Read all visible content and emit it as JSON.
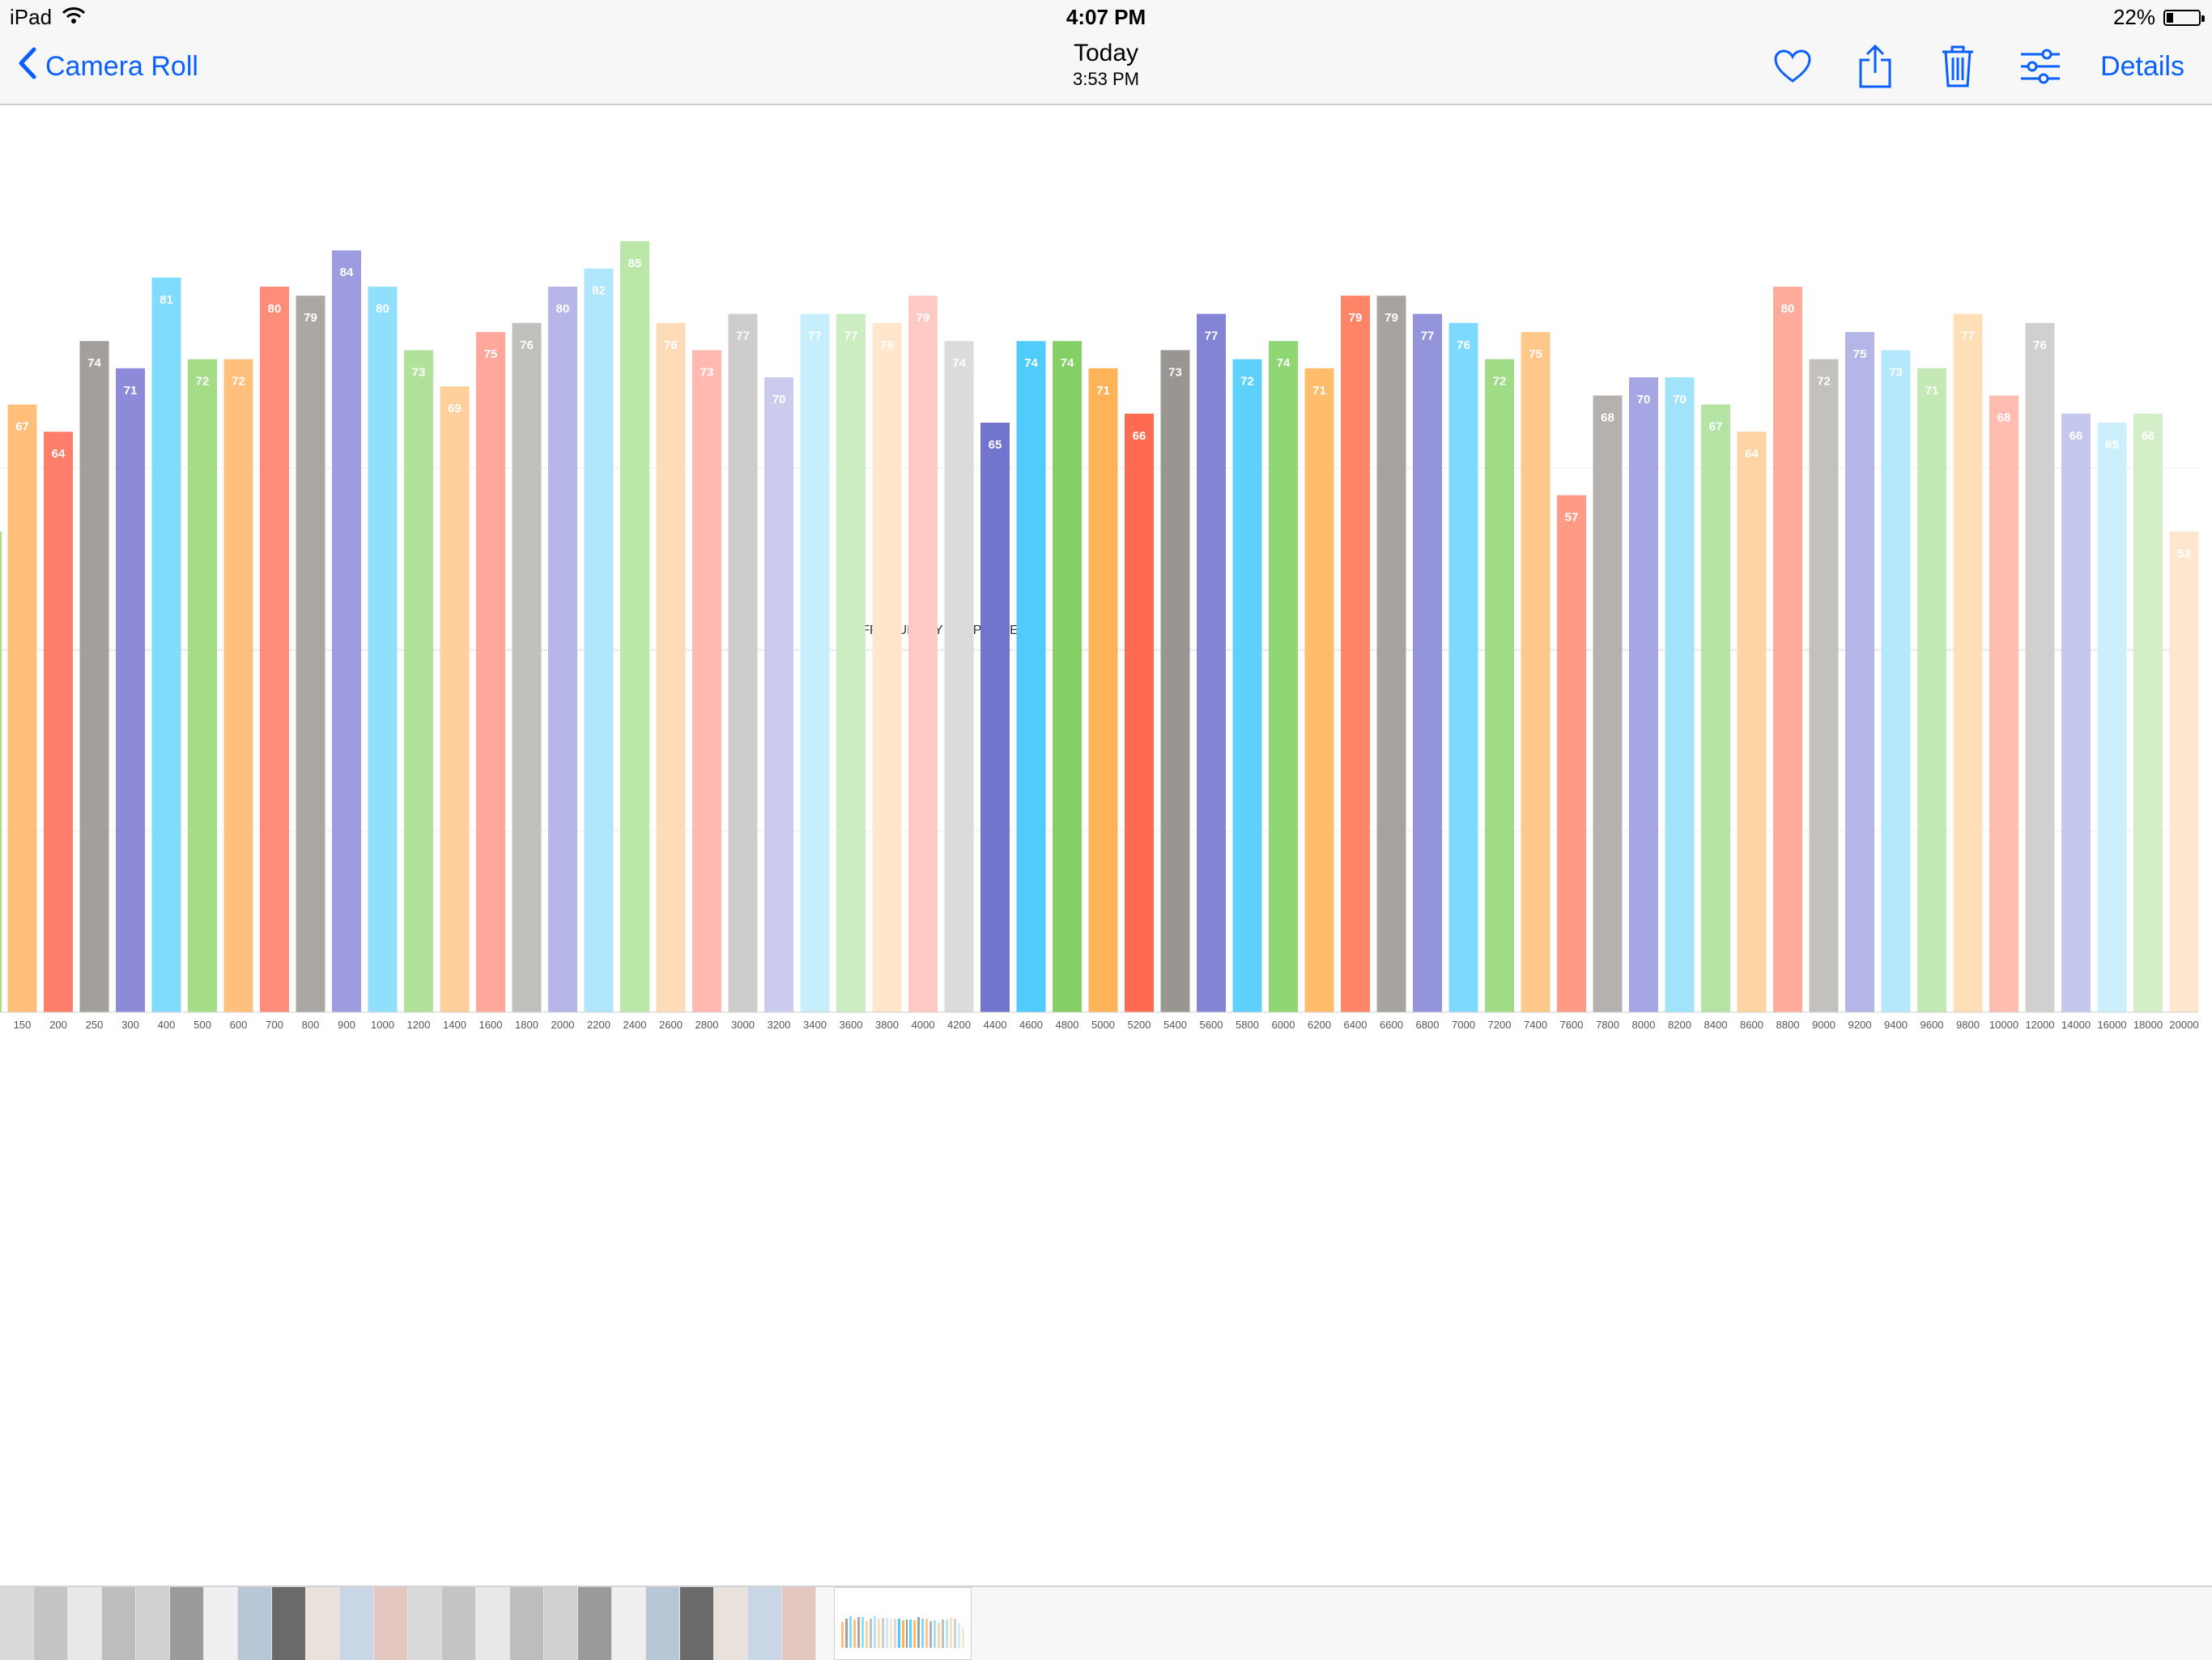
{
  "status_bar": {
    "device": "iPad",
    "time": "4:07 PM",
    "battery": "22%",
    "battery_level": 0.22
  },
  "nav": {
    "back_label": "Camera Roll",
    "title": "Today",
    "subtitle": "3:53 PM",
    "details_label": "Details"
  },
  "accent_color": "#0a60ff",
  "icons": [
    "back-chevron-icon",
    "wifi-icon",
    "battery-icon",
    "heart-icon",
    "share-icon",
    "trash-icon",
    "edit-sliders-icon"
  ],
  "chart_data": {
    "type": "bar",
    "title": "FREQUENCY RESPONSE",
    "categories": [
      "150",
      "200",
      "250",
      "300",
      "400",
      "500",
      "600",
      "700",
      "800",
      "900",
      "1000",
      "1200",
      "1400",
      "1600",
      "1800",
      "2000",
      "2200",
      "2400",
      "2600",
      "2800",
      "3000",
      "3200",
      "3400",
      "3600",
      "3800",
      "4000",
      "4200",
      "4400",
      "4600",
      "4800",
      "5000",
      "5200",
      "5400",
      "5600",
      "5800",
      "6000",
      "6200",
      "6400",
      "6600",
      "6800",
      "7000",
      "7200",
      "7400",
      "7600",
      "7800",
      "8000",
      "8200",
      "8400",
      "8600",
      "8800",
      "9000",
      "9200",
      "9400",
      "9600",
      "9800",
      "10000",
      "12000",
      "14000",
      "16000",
      "18000",
      "20000"
    ],
    "values": [
      67,
      64,
      74,
      71,
      81,
      72,
      72,
      80,
      79,
      84,
      80,
      73,
      69,
      75,
      76,
      80,
      82,
      85,
      76,
      73,
      77,
      70,
      77,
      77,
      76,
      79,
      74,
      65,
      74,
      74,
      71,
      66,
      73,
      77,
      72,
      74,
      71,
      79,
      79,
      77,
      76,
      72,
      75,
      57,
      68,
      70,
      70,
      67,
      64,
      80,
      72,
      75,
      73,
      71,
      77,
      68,
      76,
      66,
      65,
      66,
      53
    ],
    "colors": [
      "#ffbf7a",
      "#ff7d6b",
      "#a39f9a",
      "#8d8bd9",
      "#80dcfc",
      "#a5dc88",
      "#ffc07e",
      "#ff8c78",
      "#aba7a4",
      "#9d9ce0",
      "#8fdffd",
      "#b1e29a",
      "#ffcf9c",
      "#ffa79a",
      "#c2c0bd",
      "#b6b7e8",
      "#afe7fc",
      "#bbe7a9",
      "#ffdcb8",
      "#ffb9b0",
      "#cfcdcb",
      "#cbcbee",
      "#c6eefd",
      "#ccedc1",
      "#ffe6cd",
      "#ffcac4",
      "#dcdbdb",
      "#7275cd",
      "#4fcbfc",
      "#86cf64",
      "#ffb359",
      "#ff6b51",
      "#999591",
      "#8384d4",
      "#5ed1fd",
      "#8fd772",
      "#ffbc6b",
      "#ff8468",
      "#a7a39f",
      "#9394dc",
      "#7dd9fd",
      "#a0db86",
      "#ffc88a",
      "#ff9a86",
      "#b4b1ae",
      "#a5a6e3",
      "#a2e3fc",
      "#b4e4a3",
      "#ffd4a3",
      "#ffab9b",
      "#c3c1be",
      "#b5b6e8",
      "#b4e8fd",
      "#c3eab5",
      "#ffdfb7",
      "#ffbcb1",
      "#d2d0ce",
      "#c6c7ee",
      "#cceffd",
      "#d4efc8",
      "#ffe7cf"
    ],
    "ylim": [
      0,
      100
    ]
  },
  "filmstrip": {
    "thumb_count": 24
  }
}
